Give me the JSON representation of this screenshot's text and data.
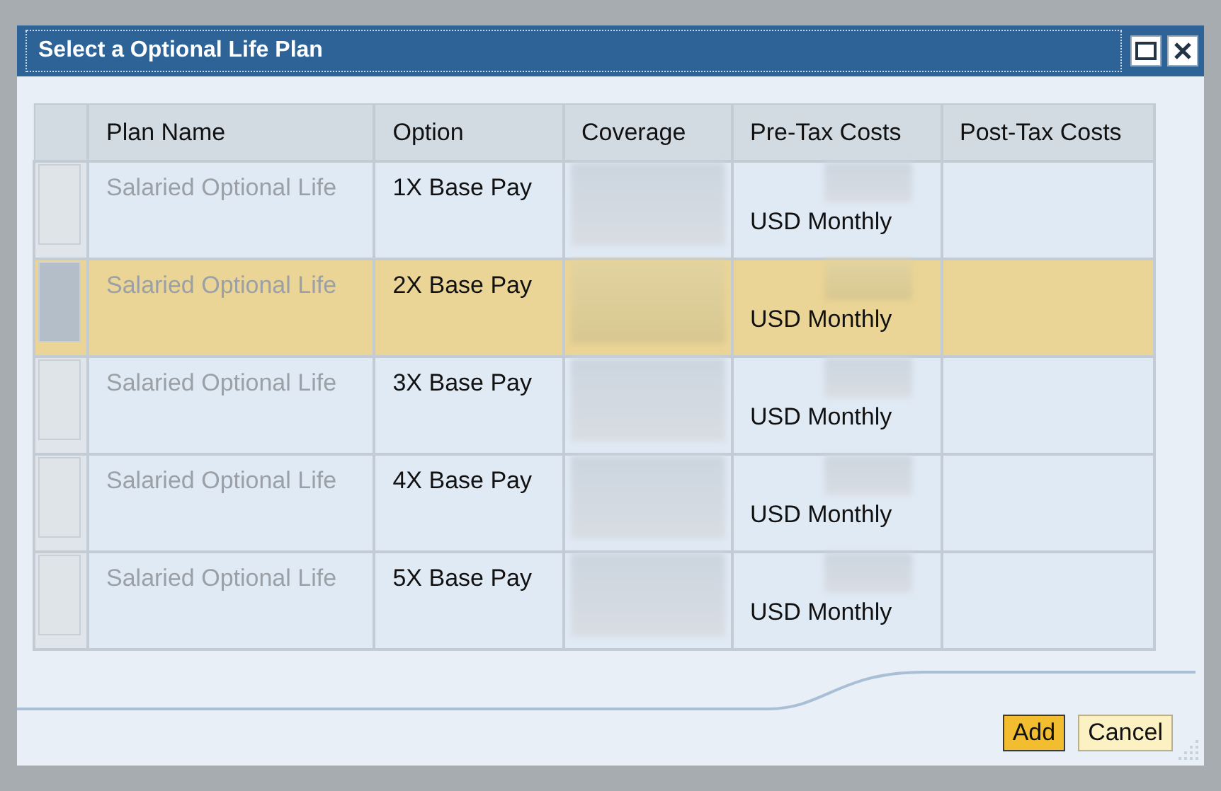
{
  "window": {
    "title": "Select a Optional Life Plan"
  },
  "table": {
    "columns": [
      "Plan Name",
      "Option",
      "Coverage",
      "Pre-Tax Costs",
      "Post-Tax Costs"
    ],
    "rows": [
      {
        "plan_name": "Salaried Optional Life",
        "option": "1X Base Pay",
        "pre_tax_costs": "USD Monthly",
        "selected": false
      },
      {
        "plan_name": "Salaried Optional Life",
        "option": "2X Base Pay",
        "pre_tax_costs": "USD Monthly",
        "selected": true
      },
      {
        "plan_name": "Salaried Optional Life",
        "option": "3X Base Pay",
        "pre_tax_costs": "USD Monthly",
        "selected": false
      },
      {
        "plan_name": "Salaried Optional Life",
        "option": "4X Base Pay",
        "pre_tax_costs": "USD Monthly",
        "selected": false
      },
      {
        "plan_name": "Salaried Optional Life",
        "option": "5X Base Pay",
        "pre_tax_costs": "USD Monthly",
        "selected": false
      }
    ]
  },
  "buttons": [
    {
      "label": "Add",
      "kind": "primary"
    },
    {
      "label": "Cancel",
      "kind": "secondary"
    }
  ]
}
